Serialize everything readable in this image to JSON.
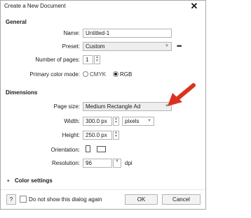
{
  "dialog": {
    "title": "Create a New Document",
    "close_glyph": "✕",
    "general": {
      "heading": "General",
      "name_label": "Name:",
      "name_value": "Untitled-1",
      "preset_label": "Preset:",
      "preset_value": "Custom",
      "more_glyph": "•••",
      "pages_label": "Number of pages:",
      "pages_value": "1",
      "color_mode_label": "Primary color mode:",
      "color_modes": [
        "CMYK",
        "RGB"
      ],
      "color_mode_selected": "RGB"
    },
    "dimensions": {
      "heading": "Dimensions",
      "page_size_label": "Page size:",
      "page_size_value": "Medium Rectangle Ad",
      "width_label": "Width:",
      "width_value": "300.0 px",
      "units_value": "pixels",
      "height_label": "Height:",
      "height_value": "250.0 px",
      "orientation_label": "Orientation:",
      "resolution_label": "Resolution:",
      "resolution_value": "96",
      "resolution_unit": "dpi"
    },
    "color_settings": {
      "toggle_glyph": "▾",
      "label": "Color settings"
    },
    "footer": {
      "help_glyph": "?",
      "dont_show_label": "Do not show this dialog again",
      "ok_label": "OK",
      "cancel_label": "Cancel"
    }
  },
  "annotation": {
    "arrow_color": "#d9321f"
  }
}
